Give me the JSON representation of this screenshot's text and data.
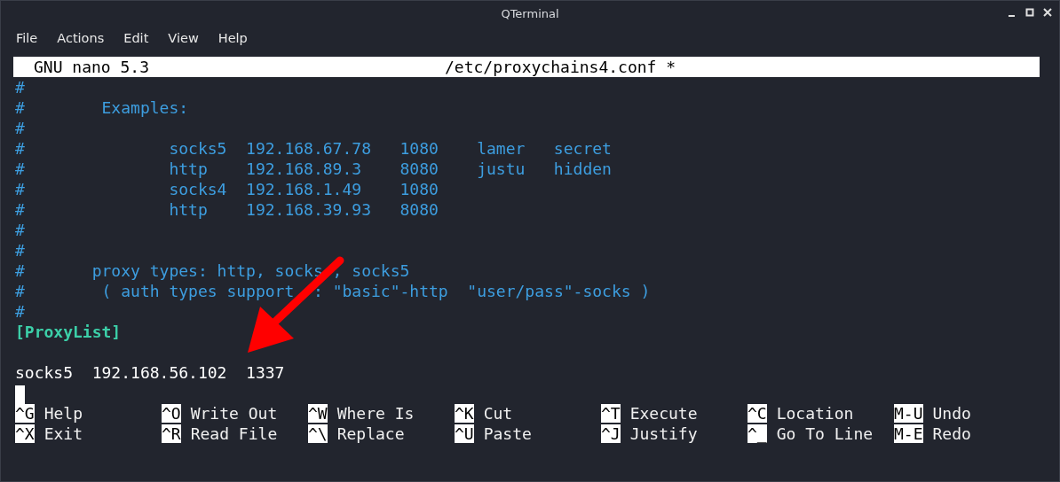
{
  "window": {
    "title": "QTerminal"
  },
  "menu": [
    "File",
    "Actions",
    "Edit",
    "View",
    "Help"
  ],
  "nano": {
    "version": "GNU nano 5.3",
    "filename": "/etc/proxychains4.conf *"
  },
  "lines": [
    {
      "kind": "comment",
      "text": "#"
    },
    {
      "kind": "comment",
      "text": "#        Examples:"
    },
    {
      "kind": "comment",
      "text": "#"
    },
    {
      "kind": "comment",
      "text": "#               socks5  192.168.67.78   1080    lamer   secret"
    },
    {
      "kind": "comment",
      "text": "#               http    192.168.89.3    8080    justu   hidden"
    },
    {
      "kind": "comment",
      "text": "#               socks4  192.168.1.49    1080"
    },
    {
      "kind": "comment",
      "text": "#               http    192.168.39.93   8080"
    },
    {
      "kind": "comment",
      "text": "#"
    },
    {
      "kind": "comment",
      "text": "#"
    },
    {
      "kind": "comment",
      "parts": [
        "#       proxy types: http, socks",
        " , socks5"
      ]
    },
    {
      "kind": "comment",
      "parts": [
        "#        ( auth types support",
        "  : \"basic\"-http  \"user/pass\"-socks )"
      ]
    },
    {
      "kind": "comment",
      "text": "#"
    },
    {
      "kind": "section",
      "text": "[ProxyList]"
    },
    {
      "kind": "blank"
    },
    {
      "kind": "plain",
      "text": "socks5  192.168.56.102  1337"
    },
    {
      "kind": "cursor"
    }
  ],
  "shortcuts": [
    [
      {
        "key": "^G",
        "label": "Help"
      },
      {
        "key": "^X",
        "label": "Exit"
      }
    ],
    [
      {
        "key": "^O",
        "label": "Write Out"
      },
      {
        "key": "^R",
        "label": "Read File"
      }
    ],
    [
      {
        "key": "^W",
        "label": "Where Is"
      },
      {
        "key": "^\\",
        "label": "Replace"
      }
    ],
    [
      {
        "key": "^K",
        "label": "Cut"
      },
      {
        "key": "^U",
        "label": "Paste"
      }
    ],
    [
      {
        "key": "^T",
        "label": "Execute"
      },
      {
        "key": "^J",
        "label": "Justify"
      }
    ],
    [
      {
        "key": "^C",
        "label": "Location"
      },
      {
        "key": "^_",
        "label": "Go To Line"
      }
    ],
    [
      {
        "key": "M-U",
        "label": "Undo"
      },
      {
        "key": "M-E",
        "label": "Redo"
      }
    ]
  ]
}
